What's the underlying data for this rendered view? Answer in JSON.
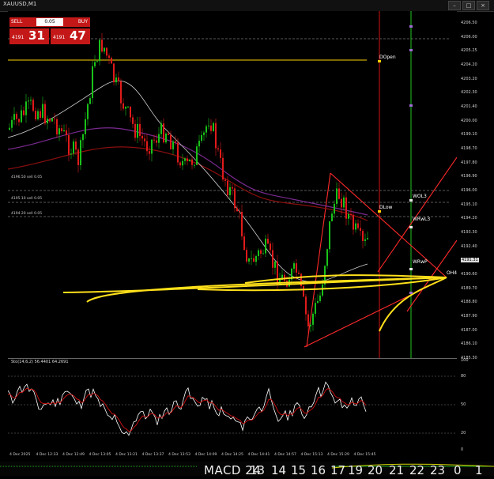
{
  "window": {
    "title": "XAUUSD,M1"
  },
  "trade_panel": {
    "sell_label": "SELL",
    "buy_label": "BUY",
    "lot": "0.05",
    "sell_small": "4191",
    "sell_big": "31",
    "buy_small": "4191",
    "buy_big": "47"
  },
  "price_axis": {
    "labels": [
      "4206.50",
      "4206.00",
      "4205.25",
      "4204.20",
      "4203.20",
      "4202.30",
      "4201.40",
      "4200.00",
      "4199.10",
      "4198.70",
      "4197.80",
      "4196.90",
      "4196.00",
      "4195.10",
      "4194.20",
      "4193.30",
      "4192.40",
      "4191.50",
      "4190.60",
      "4189.70",
      "4188.80",
      "4187.90",
      "4187.00",
      "4186.10",
      "4185.30"
    ],
    "current_price": "4191.31"
  },
  "chart_labels": {
    "dopen": "DOpen",
    "dlow": "DLow",
    "wol3": "WOL3",
    "wrwl3": "WRwL3",
    "wrwp": "WRwP",
    "oh4": "OH4",
    "left_tags": [
      "4196.50 sell 0.05",
      "4195.10 sell 0.05",
      "4194.20 sell 0.05"
    ]
  },
  "indicator": {
    "title": "Sto(14,6,2) 56.4401 64.2691",
    "levels": [
      "100",
      "80",
      "50",
      "20",
      "0"
    ]
  },
  "time_axis": [
    "4 Dec 2025",
    "4 Dec 12:33",
    "4 Dec 12:49",
    "4 Dec 13:05",
    "4 Dec 13:21",
    "4 Dec 13:37",
    "4 Dec 13:53",
    "4 Dec 14:09",
    "4 Dec 14:25",
    "4 Dec 14:41",
    "4 Dec 14:57",
    "4 Dec 15:13",
    "4 Dec 15:29",
    "4 Dec 15:45"
  ],
  "bottom": {
    "macd_title": "MACD 24",
    "numbers": [
      "13",
      "14",
      "15",
      "16",
      "17",
      "19",
      "20",
      "21",
      "22",
      "23",
      "0",
      "1"
    ]
  }
}
